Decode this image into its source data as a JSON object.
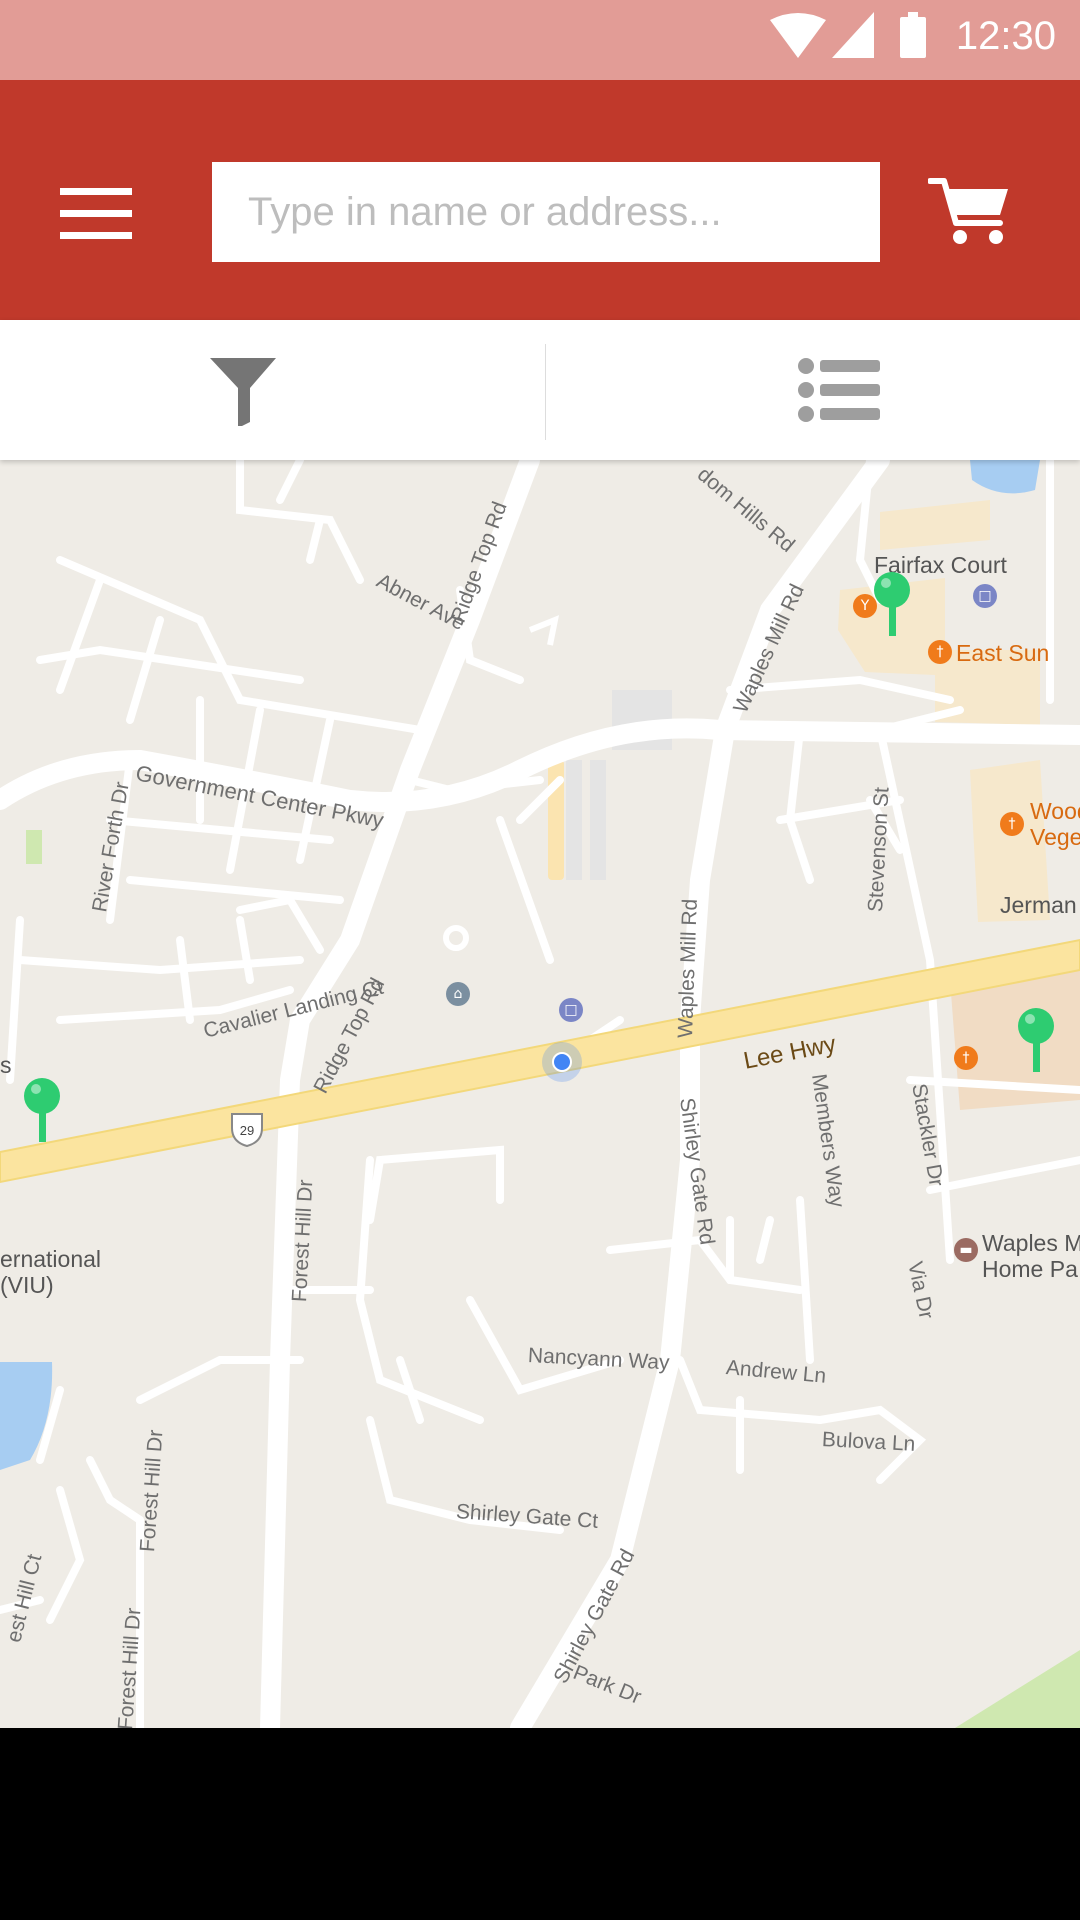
{
  "status_bar": {
    "time": "12:30",
    "icons": [
      "wifi-icon",
      "signal-icon",
      "battery-icon"
    ]
  },
  "header": {
    "menu_icon": "hamburger-menu-icon",
    "search": {
      "placeholder": "Type in name or address...",
      "value": ""
    },
    "cart_icon": "shopping-cart-icon"
  },
  "toolbar": {
    "filter_icon": "filter-funnel-icon",
    "list_icon": "list-view-icon"
  },
  "map": {
    "labels": {
      "ridge_top_rd_north": "Ridge Top Rd",
      "abner_ave": "Abner Ave",
      "freedom_hills_rd": "dom Hills Rd",
      "waples_mill_rd_north": "Waples Mill Rd",
      "fairfax_court": "Fairfax Court",
      "east_sun": "East Sun",
      "government_center_pkwy": "Government Center Pkwy",
      "river_forth_dr": "River Forth Dr",
      "stevenson_st": "Stevenson St",
      "wood_line1": "Wood",
      "wood_line2": "Vege",
      "jerman": "Jerman",
      "waples_mill_rd_mid": "Waples Mill Rd",
      "cavalier_landing_ct": "Cavalier Landing Ct",
      "ridge_top_rd_south": "Ridge Top Rd",
      "lee_hwy": "Lee Hwy",
      "route_shield": "29",
      "shirley_gate_rd_north": "Shirley Gate Rd",
      "members_way": "Members Way",
      "stackler_dr": "Stackler Dr",
      "left_s": "s",
      "forest_hill_dr_north": "Forest Hill Dr",
      "ernational": "ernational",
      "viu": "(VIU)",
      "waples_home_line1": "Waples M",
      "waples_home_line2": "Home Pa",
      "via_dr": "Via Dr",
      "nancyann_way": "Nancyann Way",
      "andrew_ln": "Andrew Ln",
      "bulova_ln": "Bulova Ln",
      "forest_hill_dr_mid": "Forest Hill Dr",
      "est_hill_ct": "est Hill Ct",
      "shirley_gate_ct": "Shirley Gate Ct",
      "shirley_gate_rd_south": "Shirley Gate Rd",
      "forest_hill_dr_south": "Forest Hill Dr",
      "park_dr": "Park Dr"
    },
    "colors": {
      "background": "#efece6",
      "road": "#ffffff",
      "highway": "#fbe49f",
      "building": "#f6e8cc",
      "water": "#a7cdf2",
      "park": "#cfe8b0",
      "pin": "#2ecc71",
      "restaurant": "#f07b1b",
      "location": "#4285f4"
    }
  }
}
